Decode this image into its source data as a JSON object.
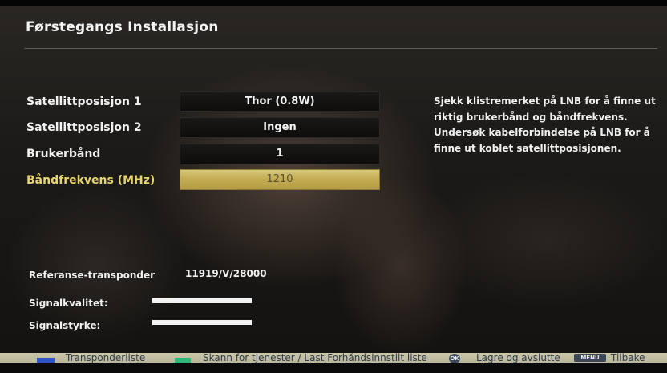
{
  "screen": {
    "title": "Førstegangs Installasjon"
  },
  "settings": [
    {
      "label": "Satellittposisjon 1",
      "value": "Thor (0.8W)",
      "selected": false
    },
    {
      "label": "Satellittposisjon 2",
      "value": "Ingen",
      "selected": false
    },
    {
      "label": "Brukerbånd",
      "value": "1",
      "selected": false
    },
    {
      "label": "Båndfrekvens (MHz)",
      "value": "1210",
      "selected": true
    }
  ],
  "help_text": "Sjekk klistremerket på LNB for å finne ut riktig brukerbånd og båndfrekvens. Undersøk kabelforbindelse på LNB for å finne ut koblet satellittposisjonen.",
  "reference": {
    "label": "Referanse-transponder",
    "value": "11919/V/28000"
  },
  "signal": {
    "quality_label": "Signalkvalitet:",
    "quality_level": 1.0,
    "strength_label": "Signalstyrke:",
    "strength_level": 1.0
  },
  "footer": {
    "blue_label": "Transponderliste",
    "green_label": "Skann for tjenester / Last Forhåndsinnstilt liste",
    "ok_key": "OK",
    "ok_label": "Lagre og avslutte",
    "menu_key": "MENU",
    "menu_label": "Tilbake"
  },
  "colors": {
    "selected_highlight": "#c8b35a",
    "selected_label": "#e6d46c",
    "blue_key": "#2f56c8",
    "green_key": "#2fb57a"
  }
}
